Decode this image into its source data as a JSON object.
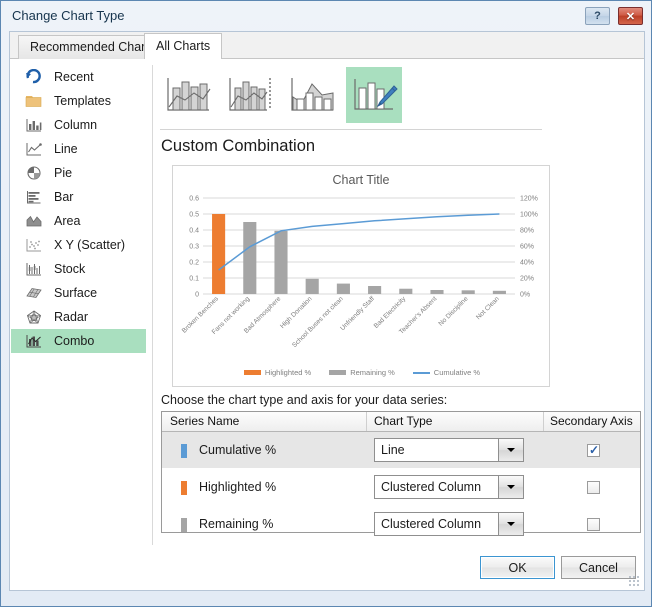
{
  "window": {
    "title": "Change Chart Type",
    "help_label": "?",
    "close_label": "✕"
  },
  "tabs": [
    {
      "label": "Recommended Charts",
      "active": false
    },
    {
      "label": "All Charts",
      "active": true
    }
  ],
  "chart_types": [
    {
      "label": "Recent",
      "icon": "recent-icon",
      "selected": false
    },
    {
      "label": "Templates",
      "icon": "templates-icon",
      "selected": false
    },
    {
      "label": "Column",
      "icon": "column-icon",
      "selected": false
    },
    {
      "label": "Line",
      "icon": "line-icon",
      "selected": false
    },
    {
      "label": "Pie",
      "icon": "pie-icon",
      "selected": false
    },
    {
      "label": "Bar",
      "icon": "bar-icon",
      "selected": false
    },
    {
      "label": "Area",
      "icon": "area-icon",
      "selected": false
    },
    {
      "label": "X Y (Scatter)",
      "icon": "scatter-icon",
      "selected": false
    },
    {
      "label": "Stock",
      "icon": "stock-icon",
      "selected": false
    },
    {
      "label": "Surface",
      "icon": "surface-icon",
      "selected": false
    },
    {
      "label": "Radar",
      "icon": "radar-icon",
      "selected": false
    },
    {
      "label": "Combo",
      "icon": "combo-icon",
      "selected": true
    }
  ],
  "thumbnails": [
    {
      "name": "clustered-column-line-thumbnail",
      "selected": false
    },
    {
      "name": "clustered-column-line-on-secondary-axis-thumbnail",
      "selected": false
    },
    {
      "name": "stacked-area-clustered-column-thumbnail",
      "selected": false
    },
    {
      "name": "custom-combination-thumbnail",
      "selected": true
    }
  ],
  "section": {
    "title": "Custom Combination"
  },
  "chart_data": {
    "type": "bar",
    "title": "Chart Title",
    "categories": [
      "Broken Benches",
      "Fans not working",
      "Bad Atmosphere",
      "High Donation",
      "School Buses not clean",
      "Unfriendly Staff",
      "Bad Electricity",
      "Teacher's Absent",
      "No Discipline",
      "Not Clean"
    ],
    "series": [
      {
        "name": "Highlighted %",
        "type": "column",
        "color": "#ed7d31",
        "axis": "primary",
        "values": [
          0.5,
          null,
          null,
          null,
          null,
          null,
          null,
          null,
          null,
          null
        ]
      },
      {
        "name": "Remaining %",
        "type": "column",
        "color": "#a5a5a5",
        "axis": "primary",
        "values": [
          null,
          0.45,
          0.395,
          0.095,
          0.065,
          0.05,
          0.033,
          0.025,
          0.023,
          0.02
        ]
      },
      {
        "name": "Cumulative %",
        "type": "line",
        "color": "#5b9bd5",
        "axis": "secondary",
        "values": [
          0.3,
          0.59,
          0.79,
          0.845,
          0.88,
          0.915,
          0.94,
          0.965,
          0.985,
          1.0
        ]
      }
    ],
    "ylabel": "",
    "xlabel": "",
    "ylim": [
      0,
      0.6
    ],
    "y_ticks": [
      "0.6",
      "0.5",
      "0.4",
      "0.3",
      "0.2",
      "0.1",
      "0"
    ],
    "y2lim": [
      0,
      1.2
    ],
    "y2_ticks": [
      "120%",
      "100%",
      "80%",
      "60%",
      "40%",
      "20%",
      "0%"
    ],
    "grid": true,
    "legend_position": "bottom",
    "legend": [
      "Highlighted %",
      "Remaining %",
      "Cumulative %"
    ]
  },
  "series_panel": {
    "instruction": "Choose the chart type and axis for your data series:",
    "headers": {
      "series_name": "Series Name",
      "chart_type": "Chart Type",
      "secondary_axis": "Secondary Axis"
    },
    "rows": [
      {
        "name": "Cumulative %",
        "color": "#5b9bd5",
        "chart_type": "Line",
        "secondary_axis": true,
        "selected": true
      },
      {
        "name": "Highlighted %",
        "color": "#ed7d31",
        "chart_type": "Clustered Column",
        "secondary_axis": false,
        "selected": false
      },
      {
        "name": "Remaining %",
        "color": "#a5a5a5",
        "chart_type": "Clustered Column",
        "secondary_axis": false,
        "selected": false
      }
    ]
  },
  "footer": {
    "ok_label": "OK",
    "cancel_label": "Cancel"
  }
}
